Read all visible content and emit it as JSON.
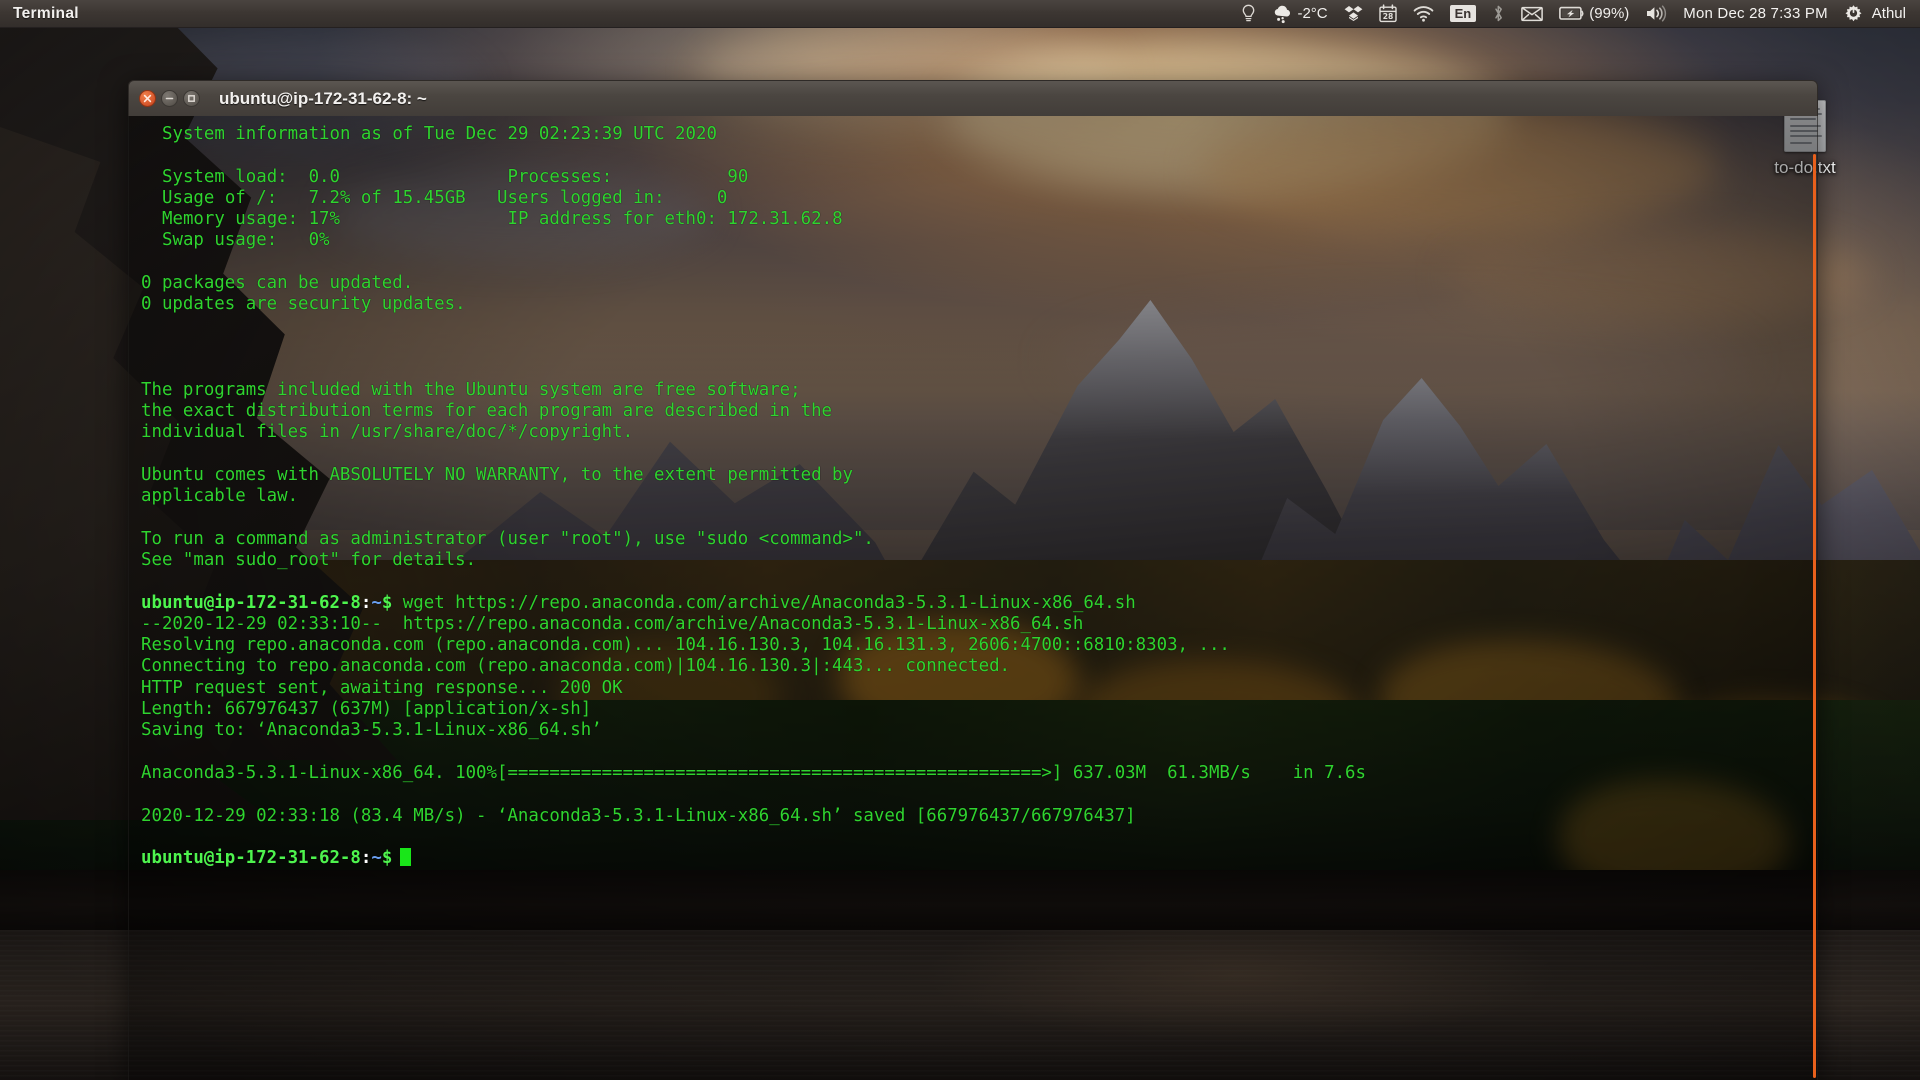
{
  "panel": {
    "title": "Terminal",
    "tray": {
      "bulb_icon": "bulb-icon",
      "weather_icon": "weather-snow-icon",
      "temperature": "-2°C",
      "dropbox_icon": "dropbox-icon",
      "calendar_icon": "calendar-icon",
      "calendar_day": "28",
      "wifi_icon": "wifi-icon",
      "keyboard_layout": "En",
      "bluetooth_icon": "bluetooth-icon",
      "mail_icon": "mail-icon",
      "battery_icon": "battery-charging-icon",
      "battery_percent": "(99%)",
      "volume_icon": "volume-icon",
      "clock": "Mon Dec 28  7:33 PM",
      "session_icon": "power-gear-icon",
      "user": "Athul"
    }
  },
  "desktop": {
    "icons": [
      {
        "label": "to-do.txt",
        "icon": "text-file-icon"
      }
    ]
  },
  "terminal": {
    "title": "ubuntu@ip-172-31-62-8: ~",
    "controls": {
      "close": "close-icon",
      "minimize": "minimize-icon",
      "maximize": "maximize-icon"
    },
    "colors": {
      "text": "#2fd42f",
      "prompt_user": "#4ef44e",
      "prompt_path": "#6a9ff0",
      "cursor": "#19e619",
      "scrollbar": "#e8601c"
    },
    "lines": [
      {
        "indent": true,
        "text": "System information as of Tue Dec 29 02:23:39 UTC 2020"
      },
      {
        "indent": false,
        "text": ""
      },
      {
        "indent": true,
        "text": "System load:  0.0                Processes:           90"
      },
      {
        "indent": true,
        "text": "Usage of /:   7.2% of 15.45GB   Users logged in:     0"
      },
      {
        "indent": true,
        "text": "Memory usage: 17%                IP address for eth0: 172.31.62.8"
      },
      {
        "indent": true,
        "text": "Swap usage:   0%"
      },
      {
        "indent": false,
        "text": ""
      },
      {
        "indent": false,
        "text": "0 packages can be updated."
      },
      {
        "indent": false,
        "text": "0 updates are security updates."
      },
      {
        "indent": false,
        "text": ""
      },
      {
        "indent": false,
        "text": ""
      },
      {
        "indent": false,
        "text": ""
      },
      {
        "indent": false,
        "text": "The programs included with the Ubuntu system are free software;"
      },
      {
        "indent": false,
        "text": "the exact distribution terms for each program are described in the"
      },
      {
        "indent": false,
        "text": "individual files in /usr/share/doc/*/copyright."
      },
      {
        "indent": false,
        "text": ""
      },
      {
        "indent": false,
        "text": "Ubuntu comes with ABSOLUTELY NO WARRANTY, to the extent permitted by"
      },
      {
        "indent": false,
        "text": "applicable law."
      },
      {
        "indent": false,
        "text": ""
      },
      {
        "indent": false,
        "text": "To run a command as administrator (user \"root\"), use \"sudo <command>\"."
      },
      {
        "indent": false,
        "text": "See \"man sudo_root\" for details."
      },
      {
        "indent": false,
        "text": ""
      }
    ],
    "prompt": {
      "user_host": "ubuntu@ip-172-31-62-8",
      "colon": ":",
      "path": "~",
      "dollar": "$"
    },
    "command": " wget https://repo.anaconda.com/archive/Anaconda3-5.3.1-Linux-x86_64.sh",
    "output_lines": [
      "--2020-12-29 02:33:10--  https://repo.anaconda.com/archive/Anaconda3-5.3.1-Linux-x86_64.sh",
      "Resolving repo.anaconda.com (repo.anaconda.com)... 104.16.130.3, 104.16.131.3, 2606:4700::6810:8303, ...",
      "Connecting to repo.anaconda.com (repo.anaconda.com)|104.16.130.3|:443... connected.",
      "HTTP request sent, awaiting response... 200 OK",
      "Length: 667976437 (637M) [application/x-sh]",
      "Saving to: ‘Anaconda3-5.3.1-Linux-x86_64.sh’",
      "",
      "Anaconda3-5.3.1-Linux-x86_64. 100%[===================================================>] 637.03M  61.3MB/s    in 7.6s",
      "",
      "2020-12-29 02:33:18 (83.4 MB/s) - ‘Anaconda3-5.3.1-Linux-x86_64.sh’ saved [667976437/667976437]",
      ""
    ]
  }
}
